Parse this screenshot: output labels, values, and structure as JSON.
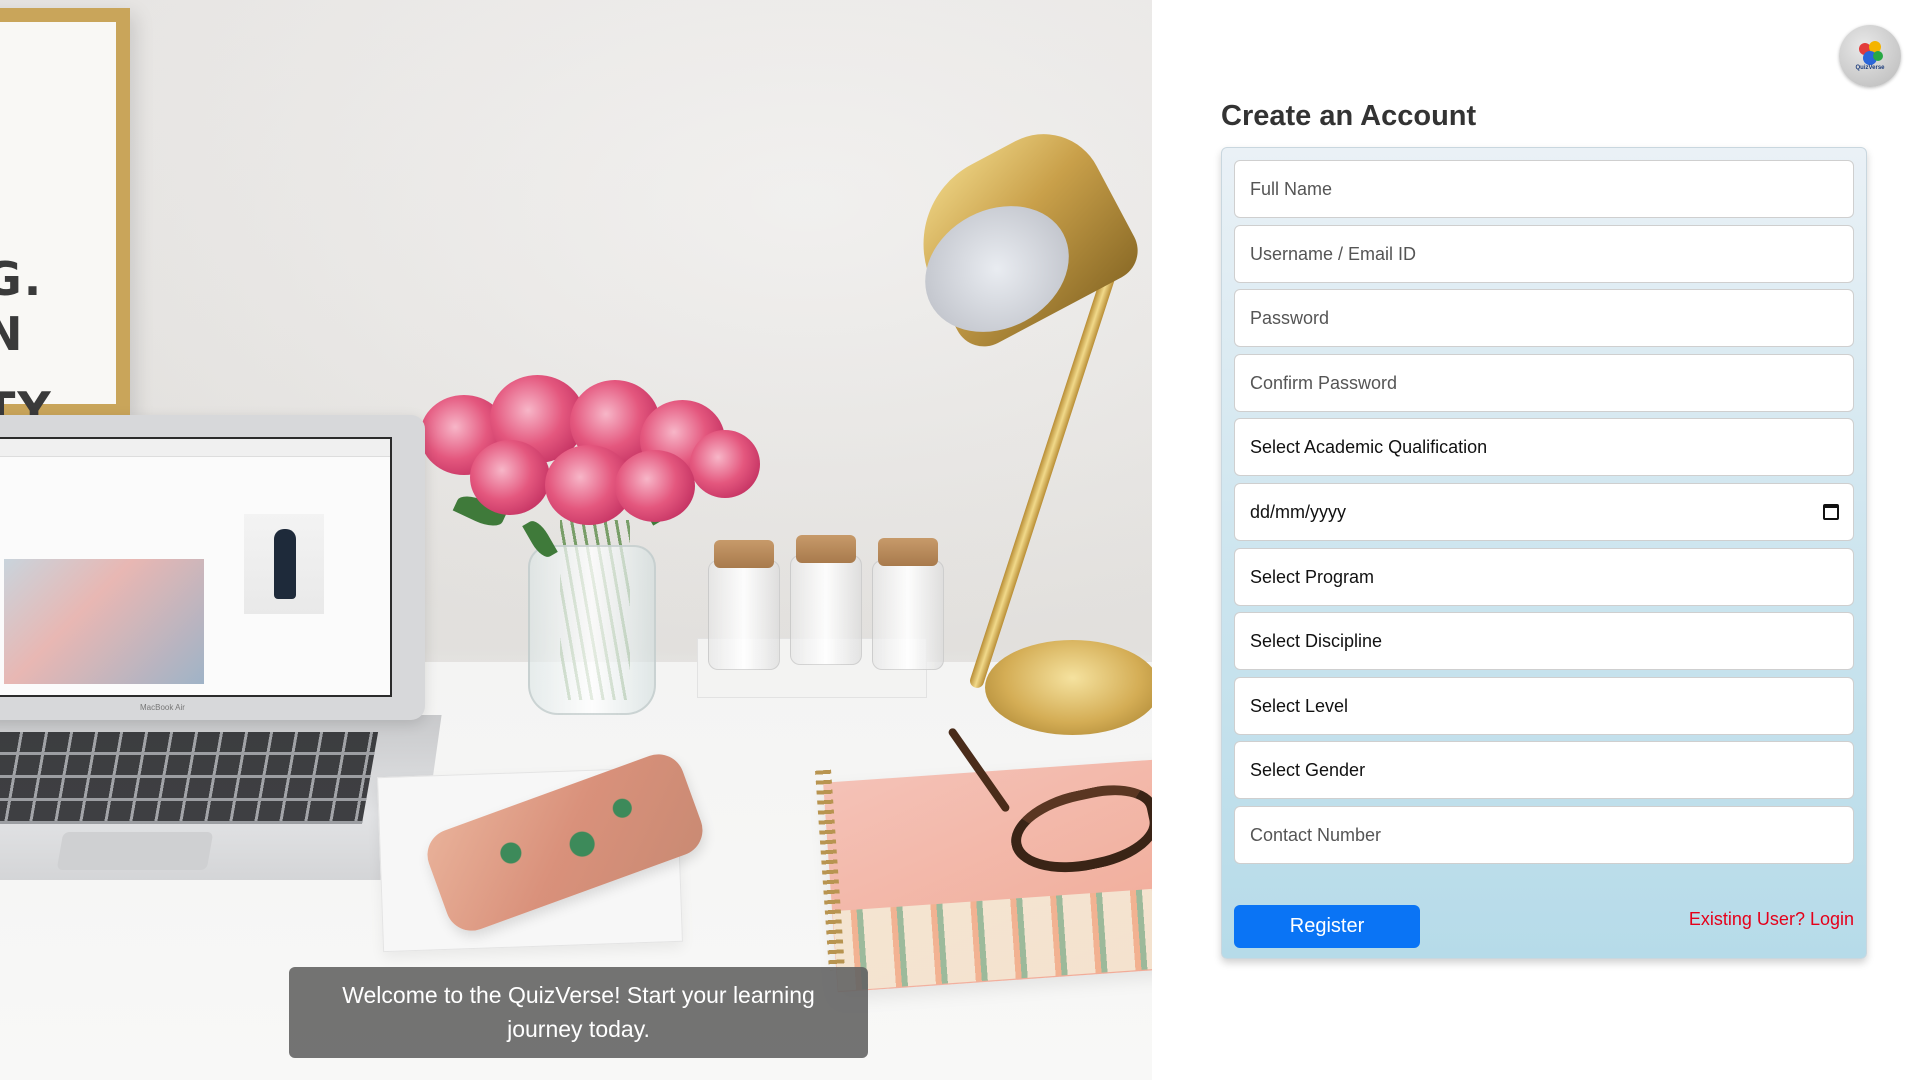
{
  "hero": {
    "welcome_text": "Welcome to the QuizVerse! Start your learning journey today.",
    "frame_letters": [
      "G.",
      "N",
      "TY"
    ],
    "laptop_brand": "MacBook Air"
  },
  "header": {
    "avatar_logo_label": "QuizVerse"
  },
  "form": {
    "title": "Create an Account",
    "fields": {
      "full_name": {
        "placeholder": "Full Name",
        "value": ""
      },
      "username": {
        "placeholder": "Username / Email ID",
        "value": ""
      },
      "password": {
        "placeholder": "Password",
        "value": ""
      },
      "confirm_password": {
        "placeholder": "Confirm Password",
        "value": ""
      },
      "qualification": {
        "selected": "Select Academic Qualification"
      },
      "dob": {
        "placeholder": "dd/mm/yyyy",
        "icon": "calendar-icon"
      },
      "program": {
        "selected": "Select Program"
      },
      "discipline": {
        "selected": "Select Discipline"
      },
      "level": {
        "selected": "Select Level"
      },
      "gender": {
        "selected": "Select Gender"
      },
      "contact": {
        "placeholder": "Contact Number",
        "value": ""
      }
    },
    "register_label": "Register",
    "login_link": "Existing User? Login"
  },
  "colors": {
    "primary_button": "#0a74f5",
    "login_link": "#e5001a",
    "card_gradient_top": "#eaf1f6",
    "card_gradient_bottom": "#b6dbe9",
    "welcome_banner": "#646464"
  }
}
